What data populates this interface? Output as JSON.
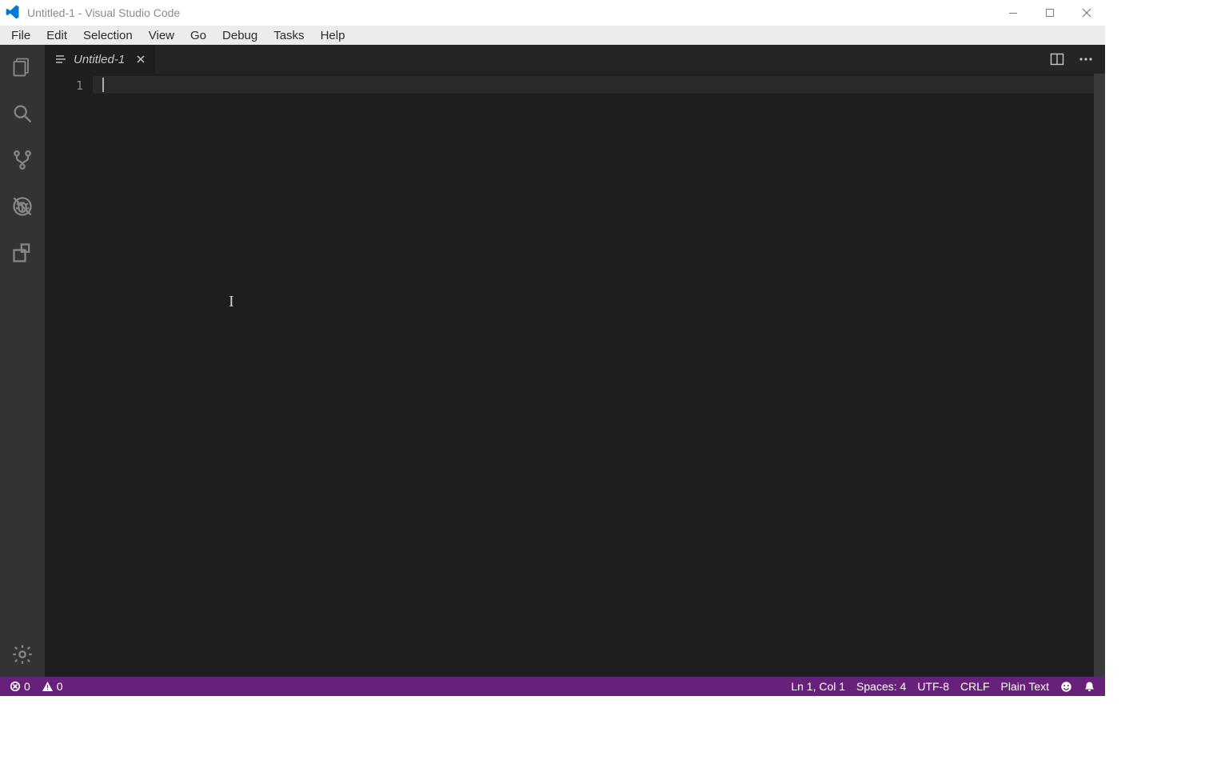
{
  "window": {
    "title": "Untitled-1 - Visual Studio Code"
  },
  "menubar": {
    "items": [
      "File",
      "Edit",
      "Selection",
      "View",
      "Go",
      "Debug",
      "Tasks",
      "Help"
    ]
  },
  "tabs": {
    "open": [
      {
        "label": "Untitled-1",
        "dirty": false
      }
    ]
  },
  "editor": {
    "line_numbers": [
      "1"
    ],
    "content": ""
  },
  "statusbar": {
    "errors": "0",
    "warnings": "0",
    "cursor": "Ln 1, Col 1",
    "indent": "Spaces: 4",
    "encoding": "UTF-8",
    "eol": "CRLF",
    "language": "Plain Text"
  }
}
